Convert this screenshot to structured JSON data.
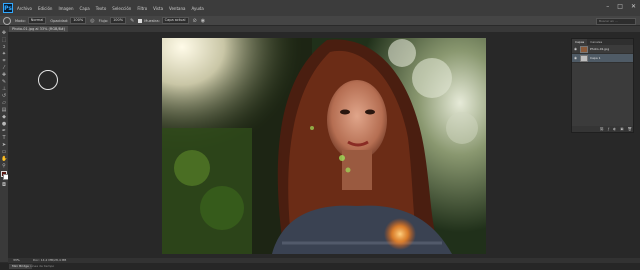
{
  "menubar": {
    "logo": "Ps",
    "items": [
      "Archivo",
      "Edición",
      "Imagen",
      "Capa",
      "Texto",
      "Selección",
      "Filtro",
      "Vista",
      "Ventana",
      "Ayuda"
    ]
  },
  "window_controls": {
    "minimize": "–",
    "maximize": "□",
    "close": "✕"
  },
  "options": {
    "mode_label": "Modo:",
    "mode_value": "Normal",
    "opacity_label": "Opacidad:",
    "opacity_value": "100%",
    "flow_label": "Flujo:",
    "flow_value": "100%",
    "sample_label": "Muestra:",
    "sample_value": "Capa actual",
    "search_placeholder": "Buscar en ..."
  },
  "document": {
    "tab_label": "Photo-01.jpg al 33% (RGB/8#)"
  },
  "layers_panel": {
    "tabs": [
      "Capas",
      "Canales"
    ],
    "layers": [
      {
        "name": "Photo-01.jpg",
        "visible": true,
        "selected": false
      },
      {
        "name": "Capa 1",
        "visible": true,
        "selected": true
      }
    ],
    "footer_icons": [
      "link-icon",
      "fx-icon",
      "mask-icon",
      "new-layer-icon",
      "trash-icon"
    ]
  },
  "status": {
    "zoom": "33%",
    "doc_info": "Doc: 14,2 MB/28,4 MB"
  },
  "bottom": {
    "tab": "Mini Bridge",
    "text": "Línea de tiempo"
  },
  "colors": {
    "foreground": "#5a1a14",
    "background": "#ffffff",
    "accent": "#31a8ff"
  }
}
